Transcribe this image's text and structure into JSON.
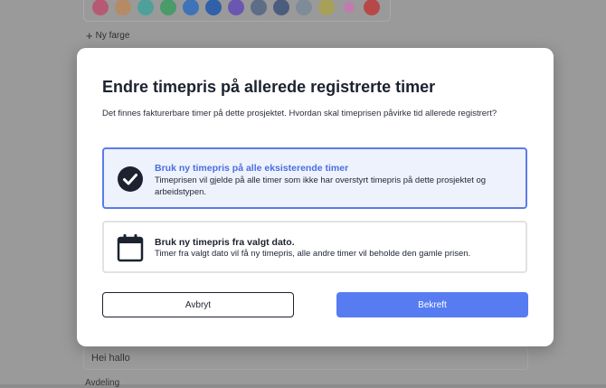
{
  "background": {
    "swatch_colors": [
      "#b65a74",
      "#b58b66",
      "#4fa09a",
      "#4a9a6a",
      "#3e73b8",
      "#3060a8",
      "#6b56b2",
      "#5d6d85",
      "#4a5d7e",
      "#7e8c98",
      "#a7a058",
      "#c07cb0",
      "#b84848"
    ],
    "new_color_label": "Ny farge",
    "input_value": "Hei hallo",
    "next_field_label": "Avdeling"
  },
  "modal": {
    "title": "Endre timepris på allerede registrerte timer",
    "description": "Det finnes fakturerbare timer på dette prosjektet. Hvordan skal timeprisen påvirke tid allerede registrert?",
    "options": [
      {
        "title": "Bruk ny timepris på alle eksisterende timer",
        "text": "Timeprisen vil gjelde på alle timer som ikke har overstyrt timepris på dette prosjektet og arbeidstypen.",
        "icon": "check-circle-icon",
        "selected": true
      },
      {
        "title": "Bruk ny timepris fra valgt dato.",
        "text": "Timer fra valgt dato vil få ny timepris, alle andre timer vil beholde den gamle prisen.",
        "icon": "calendar-icon",
        "selected": false
      }
    ],
    "cancel_label": "Avbryt",
    "confirm_label": "Bekreft"
  },
  "colors": {
    "accent": "#577cf2",
    "selected_border": "#5b7ce8",
    "selected_bg": "#eef2fd",
    "text_dark": "#1c2230"
  }
}
